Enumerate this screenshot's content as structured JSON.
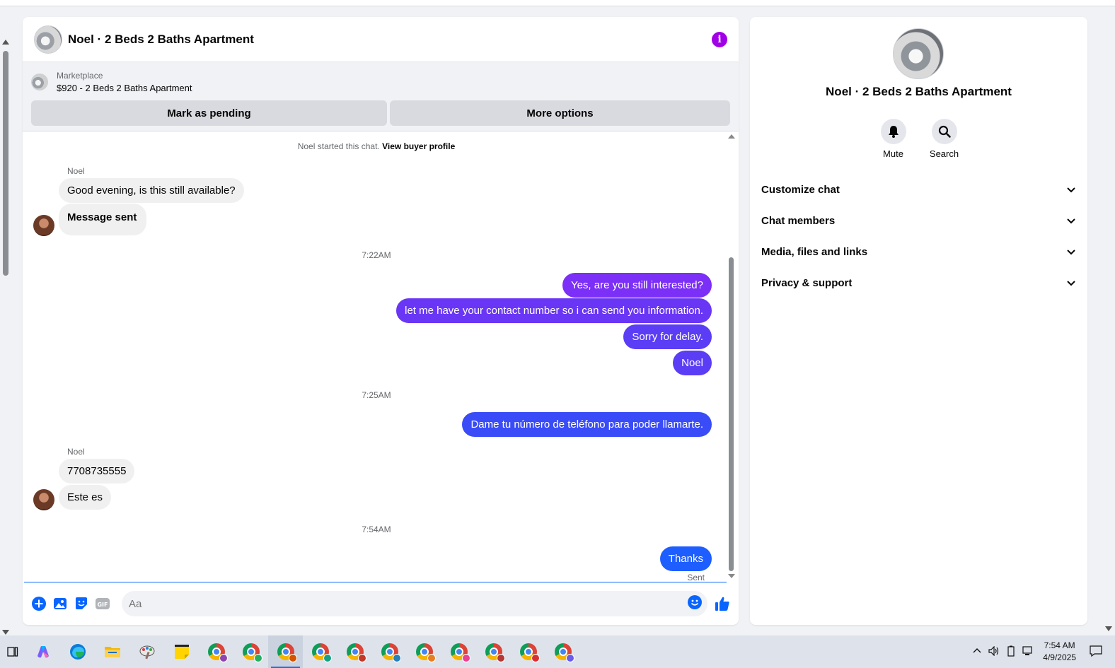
{
  "chat": {
    "title": "Noel · 2 Beds 2 Baths Apartment",
    "marketplace_label": "Marketplace",
    "listing": "$920 - 2 Beds 2 Baths Apartment",
    "mark_pending": "Mark as pending",
    "more_options": "More options",
    "started_text": "Noel started this chat.",
    "view_profile": "View buyer profile",
    "sender_name": "Noel",
    "messages": {
      "m1": "Good evening, is this still available?",
      "m2": "Message sent",
      "ts1": "7:22AM",
      "m3": "Yes, are you still interested?",
      "m4": "let me have your contact number so i can send you information.",
      "m5": "Sorry for delay.",
      "m6": "Noel",
      "ts2": "7:25AM",
      "m7": "Dame tu número de teléfono para poder llamarte.",
      "m8": "7708735555",
      "m9": "Este es",
      "ts3": "7:54AM",
      "m10": "Thanks",
      "sent": "Sent"
    },
    "composer_placeholder": "Aa",
    "colors": {
      "purple": "#7b2ff7",
      "violet": "#5b3df5",
      "blue": "#1e5eff"
    }
  },
  "info": {
    "title": "Noel · 2 Beds 2 Baths Apartment",
    "mute": "Mute",
    "search": "Search",
    "sections": [
      "Customize chat",
      "Chat members",
      "Media, files and links",
      "Privacy & support"
    ]
  },
  "taskbar": {
    "time": "7:54 AM",
    "date": "4/9/2025"
  }
}
